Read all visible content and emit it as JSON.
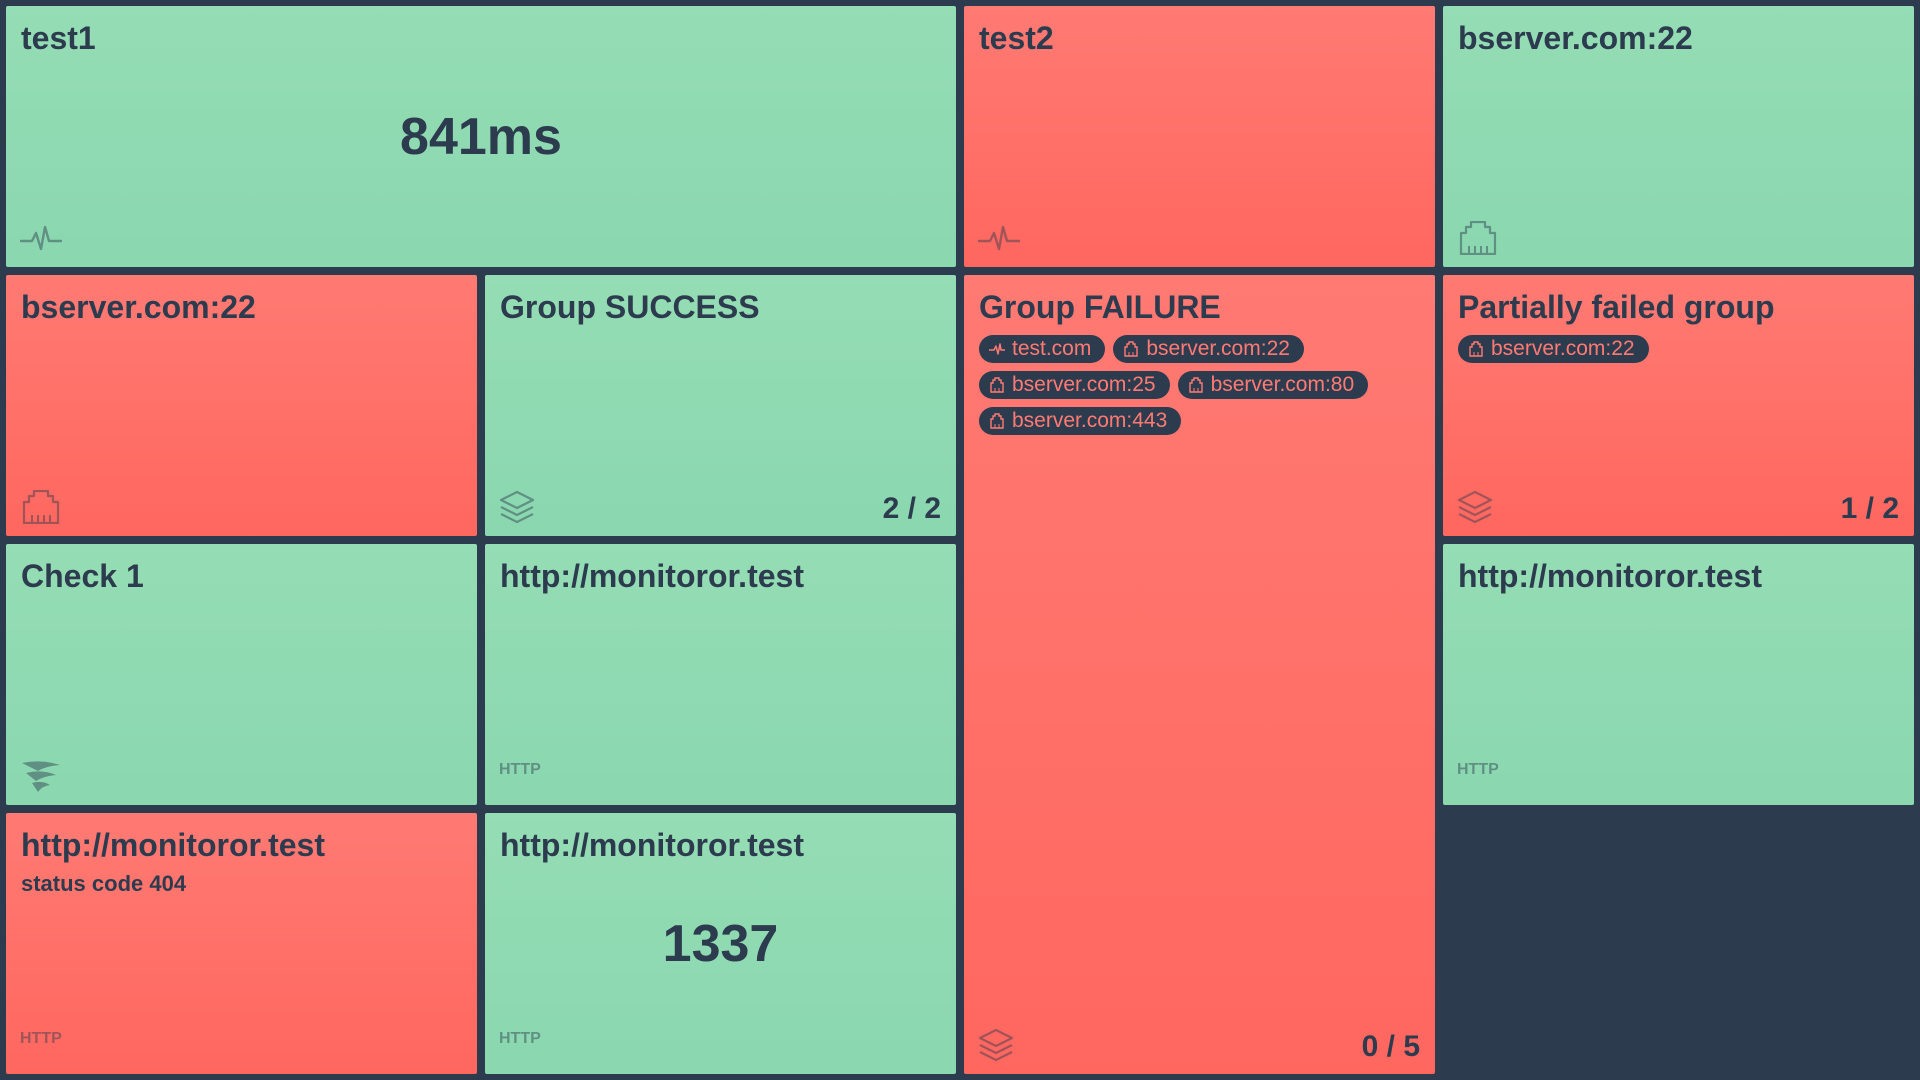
{
  "colors": {
    "background": "#2d3b4e",
    "success": "#8ed9b2",
    "failure": "#ff6f68",
    "text": "#2d3b4e"
  },
  "tiles": [
    {
      "id": "test1",
      "label": "test1",
      "value": "841ms",
      "status": "success",
      "icon": "ping-icon"
    },
    {
      "id": "test2",
      "label": "test2",
      "status": "failure",
      "icon": "ping-icon"
    },
    {
      "id": "bserver1",
      "label": "bserver.com:22",
      "status": "success",
      "icon": "port-icon"
    },
    {
      "id": "bserver2",
      "label": "bserver.com:22",
      "status": "failure",
      "icon": "port-icon"
    },
    {
      "id": "group_success",
      "label": "Group SUCCESS",
      "status": "success",
      "icon": "layers-icon",
      "count": "2 / 2"
    },
    {
      "id": "group_failure",
      "label": "Group FAILURE",
      "status": "failure",
      "icon": "layers-icon",
      "count": "0 / 5",
      "subtiles": [
        {
          "label": "test.com",
          "icon": "ping-icon"
        },
        {
          "label": "bserver.com:22",
          "icon": "port-icon"
        },
        {
          "label": "bserver.com:25",
          "icon": "port-icon"
        },
        {
          "label": "bserver.com:80",
          "icon": "port-icon"
        },
        {
          "label": "bserver.com:443",
          "icon": "port-icon"
        }
      ]
    },
    {
      "id": "partial",
      "label": "Partially failed group",
      "status": "failure",
      "icon": "layers-icon",
      "count": "1 / 2",
      "subtiles": [
        {
          "label": "bserver.com:22",
          "icon": "port-icon"
        }
      ]
    },
    {
      "id": "check1",
      "label": "Check 1",
      "status": "success",
      "icon": "solarwinds-icon"
    },
    {
      "id": "http1",
      "label": "http://monitoror.test",
      "status": "success",
      "tag": "HTTP"
    },
    {
      "id": "http2",
      "label": "http://monitoror.test",
      "status": "success",
      "tag": "HTTP"
    },
    {
      "id": "http3",
      "label": "http://monitoror.test",
      "message": "status code 404",
      "status": "failure",
      "tag": "HTTP"
    },
    {
      "id": "http4",
      "label": "http://monitoror.test",
      "value": "1337",
      "status": "success",
      "tag": "HTTP"
    }
  ]
}
